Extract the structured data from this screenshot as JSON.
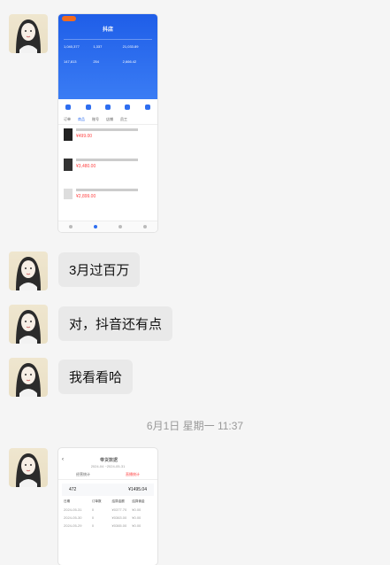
{
  "messages": [
    {
      "type": "image"
    },
    {
      "type": "text",
      "text": "3月过百万"
    },
    {
      "type": "text",
      "text": "对，抖音还有点"
    },
    {
      "type": "text",
      "text": "我看看哈"
    }
  ],
  "timestamp": "6月1日 星期一 11:37",
  "shot1": {
    "app_title": "抖店",
    "stats": [
      "1,040,377",
      "1,337",
      "21,033.89",
      "147,813",
      "254",
      "2,666.42"
    ],
    "tabs": [
      "订单",
      "商品",
      "账号",
      "店铺",
      "员工"
    ],
    "products": [
      {
        "price": "¥499.00"
      },
      {
        "price": "¥3,480.00"
      },
      {
        "price": "¥2,899.00"
      }
    ]
  },
  "shot2": {
    "title": "带货数据",
    "date_range": "2024-04 ~2024-05-31",
    "tabs": [
      "经营统计",
      "直播统计"
    ],
    "metric_left": "472",
    "metric_right": "¥1495.04",
    "columns": [
      "日期",
      "订单数",
      "结算金额",
      "结算佣金"
    ],
    "rows": [
      [
        "2024-05-31",
        "0",
        "¥0377.70",
        "¥0.00"
      ],
      [
        "2024-05-30",
        "0",
        "¥0363.00",
        "¥0.00"
      ],
      [
        "2024-05-29",
        "0",
        "¥0365.00",
        "¥0.00"
      ]
    ]
  }
}
